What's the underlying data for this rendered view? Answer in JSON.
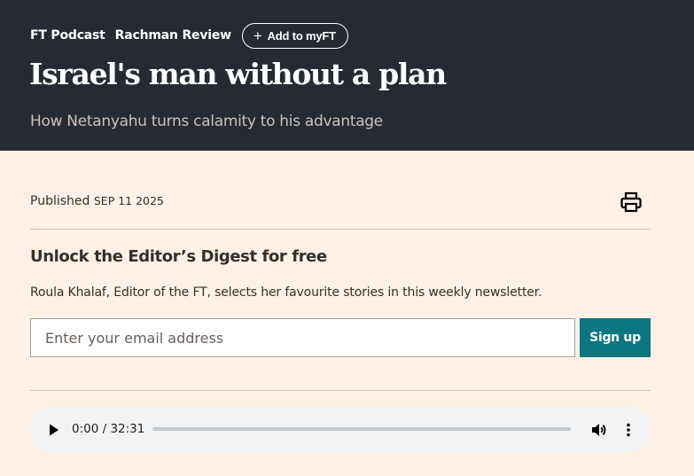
{
  "header": {
    "tags": [
      "FT Podcast",
      "Rachman Review"
    ],
    "add_button_label": "Add to myFT",
    "title": "Israel's man without a plan",
    "subtitle": "How Netanyahu turns calamity to his advantage"
  },
  "meta": {
    "published_label": "Published",
    "published_date": "SEP 11 2025"
  },
  "digest": {
    "title": "Unlock the Editor’s Digest for free",
    "text": "Roula Khalaf, Editor of the FT, selects her favourite stories in this weekly newsletter.",
    "email_placeholder": "Enter your email address",
    "signup_label": "Sign up"
  },
  "audio": {
    "time_display": "0:00 / 32:31",
    "progress": 0
  },
  "icons": {
    "print": "print-icon",
    "plus": "plus-icon",
    "play": "play-icon",
    "volume": "volume-icon",
    "more": "more-vert-icon"
  },
  "colors": {
    "header_bg": "#262a33",
    "page_bg": "#fff1e5",
    "accent": "#0d7680",
    "player_bg": "#f1f3f4"
  }
}
